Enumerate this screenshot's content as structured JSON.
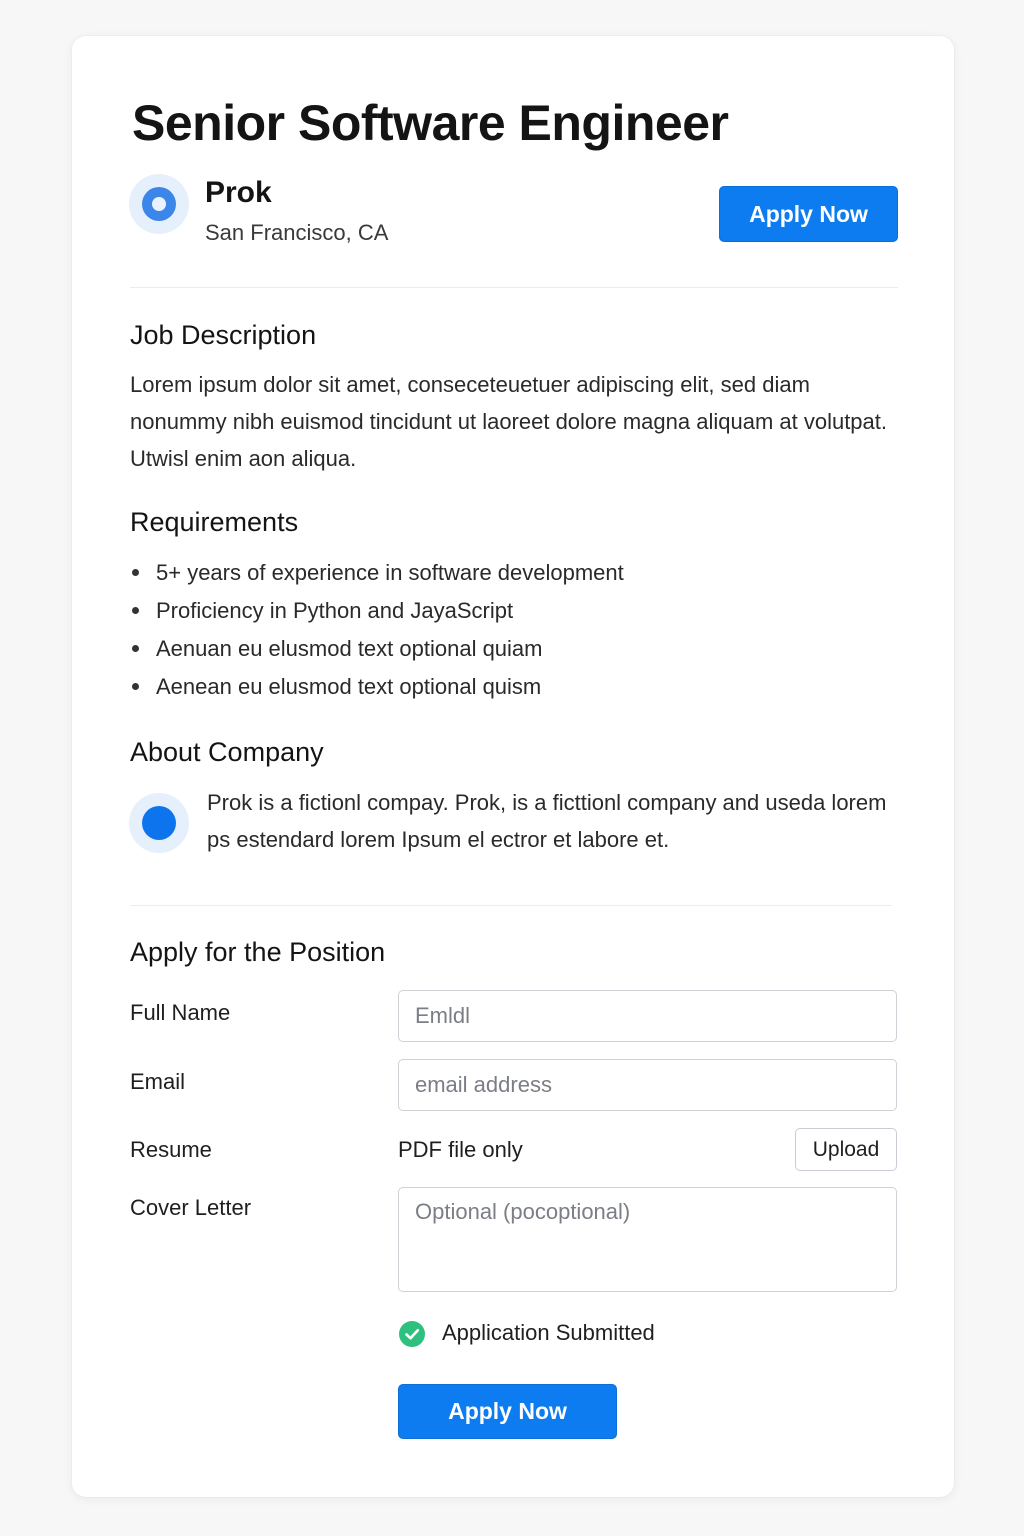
{
  "job": {
    "title": "Senior Software Engineer",
    "apply_label": "Apply Now"
  },
  "company": {
    "name": "Prok",
    "location": "San Francisco, CA"
  },
  "description": {
    "heading": "Job Description",
    "text": "Lorem ipsum dolor sit amet, conseceteuetuer adipiscing elit, sed diam nonummy nibh euismod tincidunt ut laoreet dolore magna aliquam at volutpat. Utwisl enim aon aliqua."
  },
  "requirements": {
    "heading": "Requirements",
    "items": [
      "5+ years of experience in software development",
      "Proficiency in Python and JayaScript",
      "Aenuan eu elusmod text optional quiam",
      "Aenean eu elusmod text optional quism"
    ]
  },
  "about": {
    "heading": "About Company",
    "text": "Prok is a fictionl compay. Prok, is a ficttionl company and useda lorem ps estendard lorem Ipsum el ectror et labore et."
  },
  "application": {
    "heading": "Apply for the Position",
    "full_name_label": "Full Name",
    "full_name_placeholder": "Emldl",
    "email_label": "Email",
    "email_placeholder": "email address",
    "resume_label": "Resume",
    "resume_hint": "PDF file only",
    "upload_label": "Upload",
    "cover_letter_label": "Cover Letter",
    "cover_letter_placeholder": "Optional (pocoptional)",
    "status_text": "Application Submitted",
    "submit_label": "Apply Now"
  },
  "colors": {
    "accent": "#0d7cf0",
    "success": "#2fc07f",
    "logo_bg": "#e6f0fd"
  },
  "icons": {
    "company_logo": "company-logo-icon",
    "about_logo": "company-dot-icon",
    "status": "check-circle-icon"
  }
}
